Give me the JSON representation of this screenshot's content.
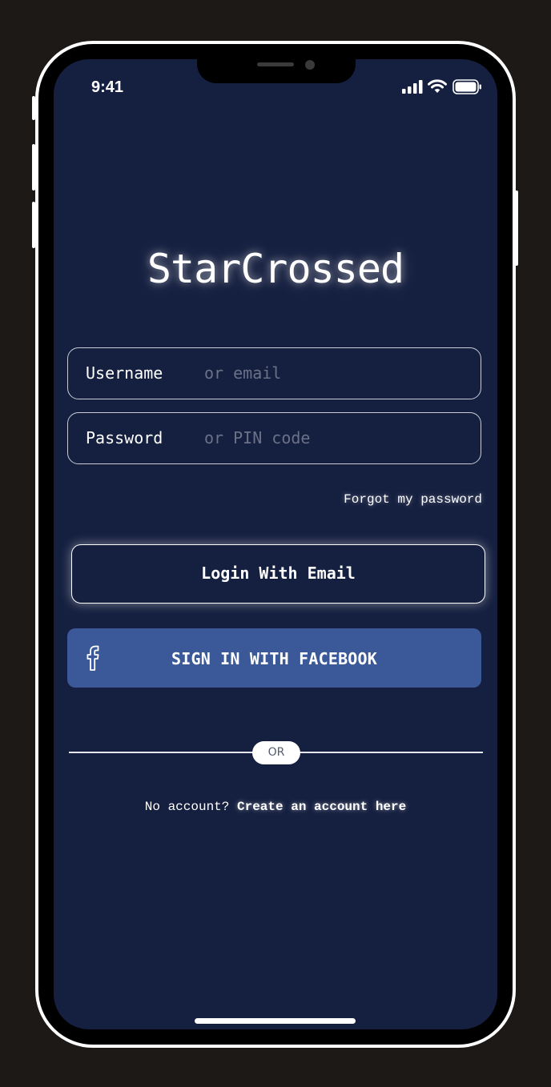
{
  "status_bar": {
    "time": "9:41",
    "icons": [
      "cellular-signal-icon",
      "wifi-icon",
      "battery-icon"
    ]
  },
  "app": {
    "title": "StarCrossed"
  },
  "login_form": {
    "username": {
      "label": "Username",
      "placeholder": "or email",
      "value": ""
    },
    "password": {
      "label": "Password",
      "placeholder": "or PIN code",
      "value": ""
    },
    "forgot_password_label": "Forgot my password",
    "login_button_label": "Login With Email",
    "facebook_button_label": "SIGN IN WITH FACEBOOK",
    "facebook_icon": "facebook-icon"
  },
  "divider": {
    "label": "OR"
  },
  "signup": {
    "prompt": "No account?",
    "link_label": "Create an account here"
  },
  "colors": {
    "background": "#1c1916",
    "screen": "#151f3f",
    "facebook": "#3b5998",
    "text": "#ffffff",
    "placeholder": "#6b7186"
  }
}
